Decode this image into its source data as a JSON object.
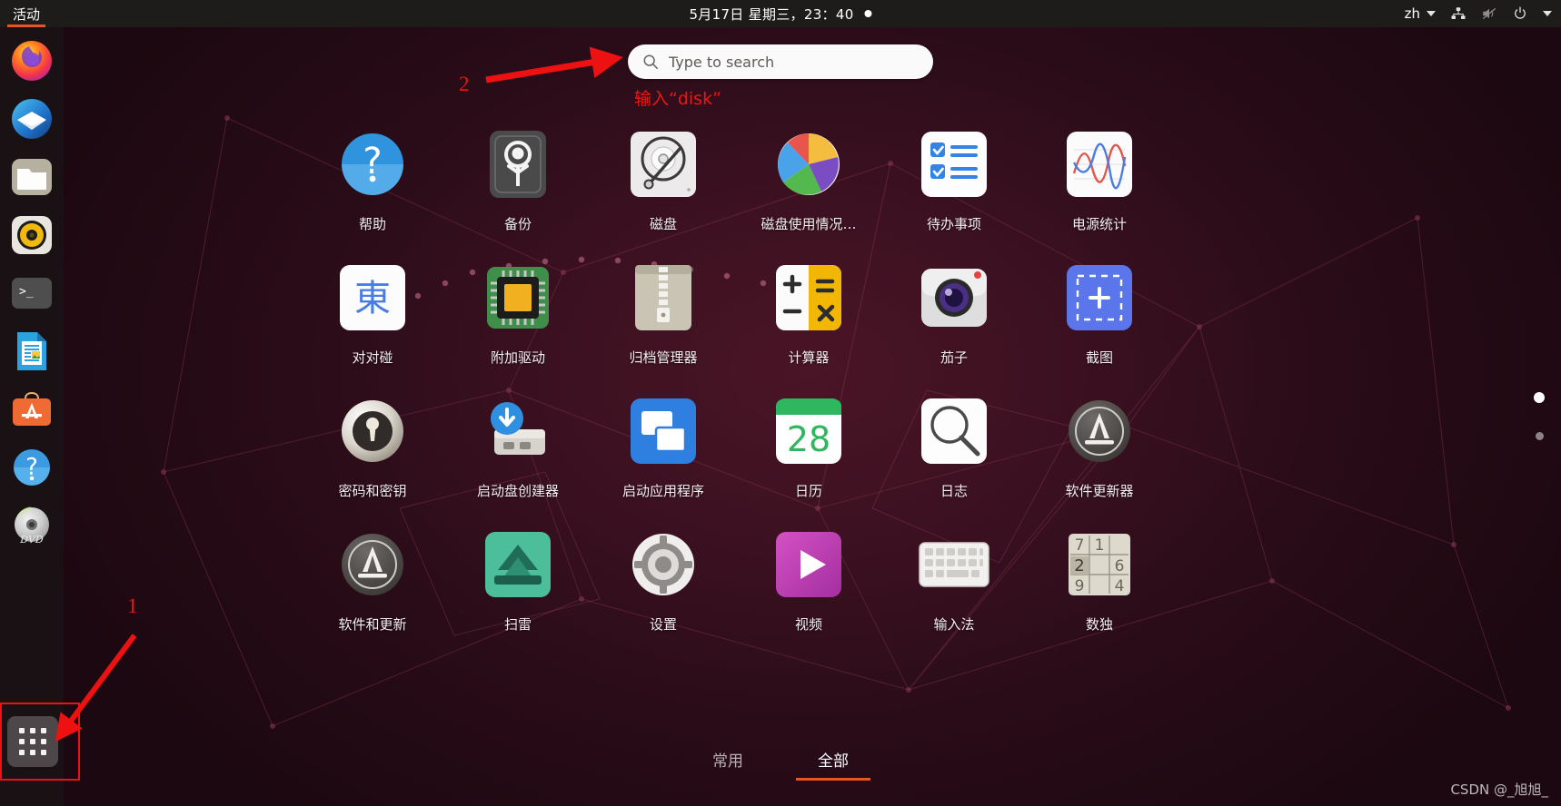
{
  "topbar": {
    "activities": "活动",
    "clock": "5月17日 星期三，23：40",
    "notification_dot": "●",
    "language": "zh",
    "icons": [
      "network-icon",
      "volume-muted-icon",
      "power-icon",
      "menu-caret-icon"
    ]
  },
  "dock": {
    "items": [
      {
        "name": "firefox",
        "label": "Firefox"
      },
      {
        "name": "thunderbird",
        "label": "Thunderbird"
      },
      {
        "name": "files",
        "label": "文件"
      },
      {
        "name": "rhythmbox",
        "label": "Rhythmbox"
      },
      {
        "name": "terminal",
        "label": "终端"
      },
      {
        "name": "libreoffice-writer",
        "label": "LibreOffice Writer"
      },
      {
        "name": "ubuntu-software",
        "label": "Ubuntu 软件"
      },
      {
        "name": "help",
        "label": "帮助"
      },
      {
        "name": "dvd-drive",
        "label": "DVD"
      }
    ],
    "show_applications": "显示应用程序"
  },
  "search": {
    "placeholder": "Type to search",
    "value": ""
  },
  "apps": [
    {
      "label": "帮助",
      "icon": "help-icon"
    },
    {
      "label": "备份",
      "icon": "backup-icon"
    },
    {
      "label": "磁盘",
      "icon": "disks-icon"
    },
    {
      "label": "磁盘使用情况…",
      "icon": "disk-usage-analyzer-icon"
    },
    {
      "label": "待办事项",
      "icon": "todo-icon"
    },
    {
      "label": "电源统计",
      "icon": "power-statistics-icon"
    },
    {
      "label": "对对碰",
      "icon": "quadrapassel-icon"
    },
    {
      "label": "附加驱动",
      "icon": "additional-drivers-icon"
    },
    {
      "label": "归档管理器",
      "icon": "archive-manager-icon"
    },
    {
      "label": "计算器",
      "icon": "calculator-icon"
    },
    {
      "label": "茄子",
      "icon": "cheese-icon"
    },
    {
      "label": "截图",
      "icon": "screenshot-icon"
    },
    {
      "label": "密码和密钥",
      "icon": "passwords-and-keys-icon"
    },
    {
      "label": "启动盘创建器",
      "icon": "startup-disk-creator-icon"
    },
    {
      "label": "启动应用程序",
      "icon": "startup-applications-icon"
    },
    {
      "label": "日历",
      "icon": "calendar-icon"
    },
    {
      "label": "日志",
      "icon": "logs-icon"
    },
    {
      "label": "软件更新器",
      "icon": "software-updater-icon"
    },
    {
      "label": "软件和更新",
      "icon": "software-and-updates-icon"
    },
    {
      "label": "扫雷",
      "icon": "mines-icon"
    },
    {
      "label": "设置",
      "icon": "settings-icon"
    },
    {
      "label": "视频",
      "icon": "videos-icon"
    },
    {
      "label": "输入法",
      "icon": "input-method-icon"
    },
    {
      "label": "数独",
      "icon": "sudoku-icon"
    }
  ],
  "calendar_day": "28",
  "tabs": [
    {
      "label": "常用",
      "active": false
    },
    {
      "label": "全部",
      "active": true
    }
  ],
  "page_dots": {
    "count": 2,
    "active_index": 0
  },
  "annotations": {
    "marker_one": "1",
    "marker_two": "2",
    "note_disk": "输入“disk”",
    "color": "#ee1111"
  },
  "watermark": "CSDN @_旭旭_"
}
